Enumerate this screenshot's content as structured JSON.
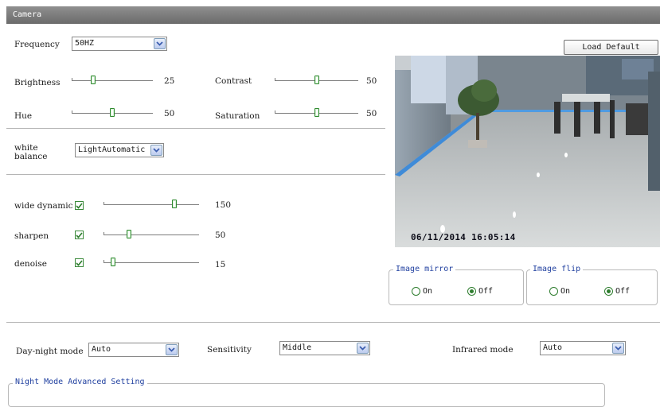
{
  "window": {
    "title": "Camera"
  },
  "frequency": {
    "label": "Frequency",
    "value": "50HZ"
  },
  "load_default": {
    "label": "Load Default"
  },
  "brightness": {
    "label": "Brightness",
    "value": "25",
    "level": 0.25
  },
  "contrast": {
    "label": "Contrast",
    "value": "50",
    "level": 0.5
  },
  "hue": {
    "label": "Hue",
    "value": "50",
    "level": 0.5
  },
  "saturation": {
    "label": "Saturation",
    "value": "50",
    "level": 0.5
  },
  "white_balance": {
    "label_line1": "white",
    "label_line2": "balance",
    "value": "LightAutomatic"
  },
  "wide_dynamic": {
    "label": "wide dynamic",
    "checked": true,
    "value": "150",
    "level": 0.75
  },
  "sharpen": {
    "label": "sharpen",
    "checked": true,
    "value": "50",
    "level": 0.25
  },
  "denoise": {
    "label": "denoise",
    "checked": true,
    "value": "15",
    "level": 0.08
  },
  "video": {
    "timestamp": "06/11/2014 16:05:14"
  },
  "image_mirror": {
    "legend": "Image mirror",
    "on_label": "On",
    "off_label": "Off",
    "selected": "Off"
  },
  "image_flip": {
    "legend": "Image flip",
    "on_label": "On",
    "off_label": "Off",
    "selected": "Off"
  },
  "day_night": {
    "label": "Day-night mode",
    "value": "Auto"
  },
  "sensitivity": {
    "label": "Sensitivity",
    "value": "Middle"
  },
  "infrared": {
    "label": "Infrared mode",
    "value": "Auto"
  },
  "night_mode": {
    "legend": "Night Mode Advanced Setting"
  },
  "colors": {
    "titlebar": "#7a7a7a",
    "legend_text": "#1f3f9f",
    "check_green": "#2e7d2e",
    "select_arrow": "#4a6bb5"
  }
}
